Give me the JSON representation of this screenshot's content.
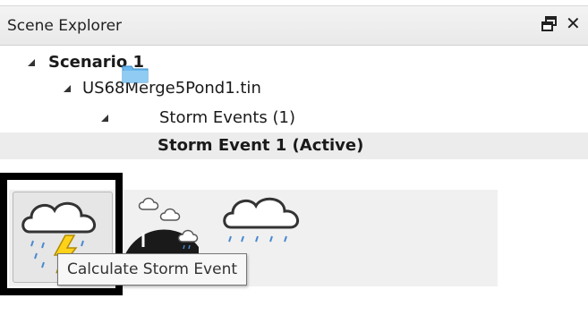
{
  "panel": {
    "title": "Scene Explorer",
    "pin_icon": "pin-float-icon",
    "close_glyph": "✕"
  },
  "tree": {
    "scenario": "Scenario 1",
    "tin": "US68Merge5Pond1.tin",
    "folder": "Storm Events (1)",
    "event": "Storm Event 1 (Active)"
  },
  "toolbar": {
    "buttons": [
      {
        "name": "calculate-storm-event",
        "icon": "storm-cloud-lightning-icon"
      },
      {
        "name": "rainfall-gauge",
        "icon": "gauge-with-clouds-icon"
      },
      {
        "name": "rain-cloud",
        "icon": "rain-cloud-icon"
      }
    ]
  },
  "tooltip": {
    "text": "Calculate Storm Event"
  },
  "colors": {
    "header_bg": "#ededed",
    "active_row_bg": "#ececec",
    "folder_blue": "#5aaee6",
    "lightning_yellow": "#ffd21a"
  }
}
